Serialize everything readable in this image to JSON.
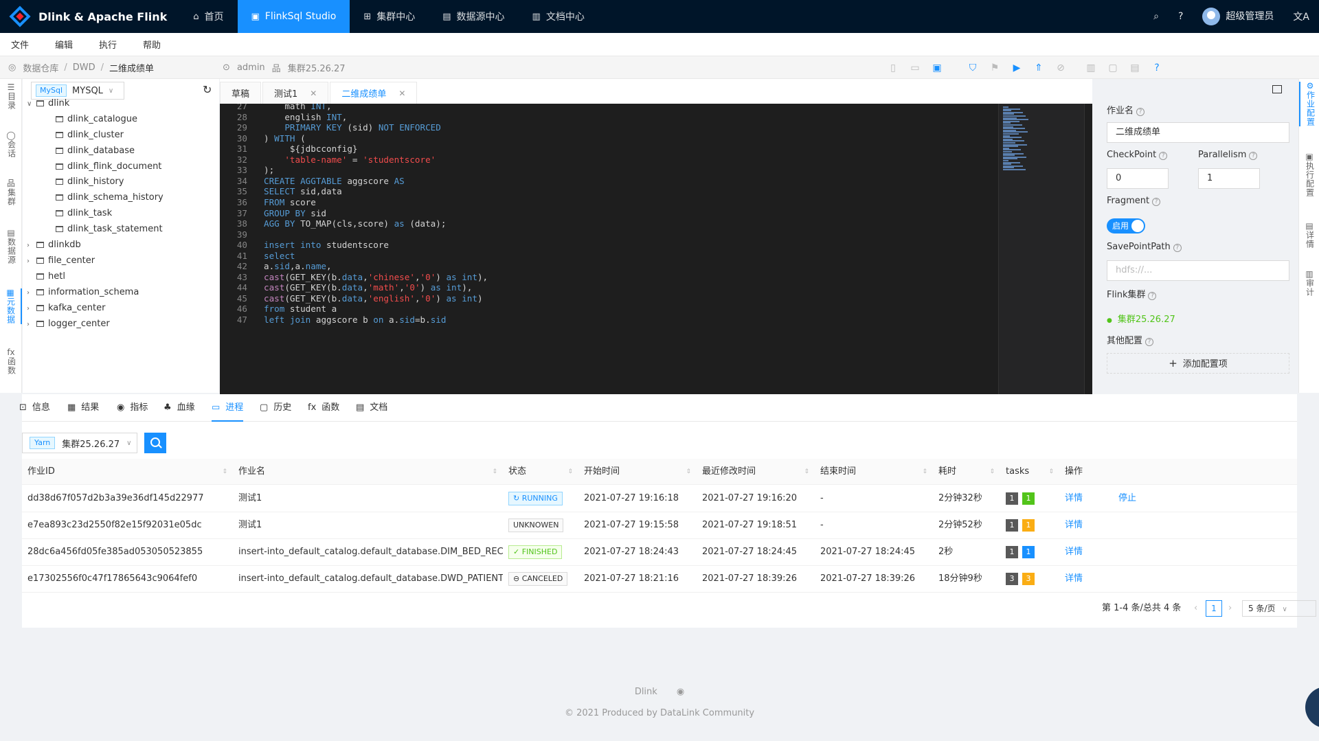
{
  "topbar": {
    "brand": "Dlink & Apache Flink",
    "nav": [
      {
        "icon": "home-icon",
        "glyph": "⌂",
        "label": "首页"
      },
      {
        "icon": "monitor-icon",
        "glyph": "▣",
        "label": "FlinkSql Studio"
      },
      {
        "icon": "cluster-icon",
        "glyph": "⊞",
        "label": "集群中心"
      },
      {
        "icon": "database-icon",
        "glyph": "▤",
        "label": "数据源中心"
      },
      {
        "icon": "document-icon",
        "glyph": "▥",
        "label": "文档中心"
      }
    ],
    "user": "超级管理员",
    "lang": "文A"
  },
  "menu": [
    "文件",
    "编辑",
    "执行",
    "帮助"
  ],
  "breadcrumb": {
    "items": [
      "数据仓库",
      "DWD"
    ],
    "current": "二维成绩单",
    "user": "admin",
    "cluster": "集群25.26.27"
  },
  "leftrail": [
    {
      "label": "目录",
      "icon": "list-icon"
    },
    {
      "label": "会话",
      "icon": "chat-icon"
    },
    {
      "label": "集群",
      "icon": "cluster-icon"
    },
    {
      "label": "数据源",
      "icon": "datasource-icon"
    },
    {
      "label": "元数据",
      "icon": "metadata-icon"
    },
    {
      "label": "函数",
      "icon": "function-icon"
    }
  ],
  "tree": {
    "db_tag": "MySql",
    "db_name": "MYSQL",
    "nodes": [
      {
        "label": "dlink",
        "expanded": true,
        "level": 0
      },
      {
        "label": "dlink_catalogue",
        "level": 1
      },
      {
        "label": "dlink_cluster",
        "level": 1
      },
      {
        "label": "dlink_database",
        "level": 1
      },
      {
        "label": "dlink_flink_document",
        "level": 1
      },
      {
        "label": "dlink_history",
        "level": 1
      },
      {
        "label": "dlink_schema_history",
        "level": 1
      },
      {
        "label": "dlink_task",
        "level": 1
      },
      {
        "label": "dlink_task_statement",
        "level": 1
      },
      {
        "label": "dlinkdb",
        "level": 0,
        "arrow": true
      },
      {
        "label": "file_center",
        "level": 0,
        "arrow": true
      },
      {
        "label": "hetl",
        "level": 0,
        "arrow": false
      },
      {
        "label": "information_schema",
        "level": 0,
        "arrow": true
      },
      {
        "label": "kafka_center",
        "level": 0,
        "arrow": true
      },
      {
        "label": "logger_center",
        "level": 0,
        "arrow": true
      }
    ]
  },
  "editor_tabs": [
    {
      "label": "草稿",
      "closable": false
    },
    {
      "label": "测试1",
      "closable": true
    },
    {
      "label": "二维成绩单",
      "closable": true,
      "active": true
    }
  ],
  "code": [
    {
      "n": "27",
      "t": "    math INT,"
    },
    {
      "n": "28",
      "t": "    english INT,"
    },
    {
      "n": "29",
      "t": "    PRIMARY KEY (sid) NOT ENFORCED"
    },
    {
      "n": "30",
      "t": ") WITH ("
    },
    {
      "n": "31",
      "t": "     ${jdbcconfig}"
    },
    {
      "n": "32",
      "t": "    'table-name' = 'studentscore'"
    },
    {
      "n": "33",
      "t": ");"
    },
    {
      "n": "34",
      "t": "CREATE AGGTABLE aggscore AS"
    },
    {
      "n": "35",
      "t": "SELECT sid,data"
    },
    {
      "n": "36",
      "t": "FROM score"
    },
    {
      "n": "37",
      "t": "GROUP BY sid"
    },
    {
      "n": "38",
      "t": "AGG BY TO_MAP(cls,score) as (data);"
    },
    {
      "n": "39",
      "t": ""
    },
    {
      "n": "40",
      "t": "insert into studentscore"
    },
    {
      "n": "41",
      "t": "select"
    },
    {
      "n": "42",
      "t": "a.sid,a.name,"
    },
    {
      "n": "43",
      "t": "cast(GET_KEY(b.data,'chinese','0') as int),"
    },
    {
      "n": "44",
      "t": "cast(GET_KEY(b.data,'math','0') as int),"
    },
    {
      "n": "45",
      "t": "cast(GET_KEY(b.data,'english','0') as int)"
    },
    {
      "n": "46",
      "t": "from student a"
    },
    {
      "n": "47",
      "t": "left join aggscore b on a.sid=b.sid"
    }
  ],
  "config": {
    "job_name_label": "作业名",
    "job_name": "二维成绩单",
    "checkpoint_label": "CheckPoint",
    "checkpoint": "0",
    "parallelism_label": "Parallelism",
    "parallelism": "1",
    "fragment_label": "Fragment",
    "fragment_switch": "启用",
    "savepoint_label": "SavePointPath",
    "savepoint_placeholder": "hdfs://...",
    "cluster_label": "Flink集群",
    "cluster": "集群25.26.27",
    "other_label": "其他配置",
    "add_label": "添加配置项"
  },
  "rightrail": [
    {
      "label": "作业配置",
      "icon": "settings-icon"
    },
    {
      "label": "执行配置",
      "icon": "execute-icon"
    },
    {
      "label": "详情",
      "icon": "detail-icon"
    },
    {
      "label": "审计",
      "icon": "audit-icon"
    }
  ],
  "bottom_tabs": [
    {
      "label": "信息",
      "icon": "terminal-icon",
      "glyph": "⊡"
    },
    {
      "label": "结果",
      "icon": "table-icon",
      "glyph": "▦"
    },
    {
      "label": "指标",
      "icon": "dashboard-icon",
      "glyph": "◉"
    },
    {
      "label": "血缘",
      "icon": "lineage-icon",
      "glyph": "♣"
    },
    {
      "label": "进程",
      "icon": "desktop-icon",
      "glyph": "▭",
      "active": true
    },
    {
      "label": "历史",
      "icon": "calendar-icon",
      "glyph": "▢"
    },
    {
      "label": "函数",
      "icon": "function-icon",
      "glyph": "fx"
    },
    {
      "label": "文档",
      "icon": "document-icon",
      "glyph": "▤"
    }
  ],
  "process": {
    "cluster_tag": "Yarn",
    "cluster": "集群25.26.27",
    "columns": [
      "作业ID",
      "作业名",
      "状态",
      "开始时间",
      "最近修改时间",
      "结束时间",
      "耗时",
      "tasks",
      "操作"
    ],
    "rows": [
      {
        "id": "dd38d67f057d2b3a39e36df145d22977",
        "name": "测试1",
        "status": "RUNNING",
        "status_type": "run",
        "start": "2021-07-27 19:16:18",
        "modified": "2021-07-27 19:16:20",
        "end": "-",
        "duration": "2分钟32秒",
        "tasks": [
          {
            "v": "1",
            "c": "gray"
          },
          {
            "v": "1",
            "c": "green"
          }
        ],
        "actions": [
          "详情",
          "停止"
        ]
      },
      {
        "id": "e7ea893c23d2550f82e15f92031e05dc",
        "name": "测试1",
        "status": "UNKNOWEN",
        "status_type": "unk",
        "start": "2021-07-27 19:15:58",
        "modified": "2021-07-27 19:18:51",
        "end": "-",
        "duration": "2分钟52秒",
        "tasks": [
          {
            "v": "1",
            "c": "gray"
          },
          {
            "v": "1",
            "c": "orange"
          }
        ],
        "actions": [
          "详情"
        ]
      },
      {
        "id": "28dc6a456fd05fe385ad053050523855",
        "name": "insert-into_default_catalog.default_database.DIM_BED_REC",
        "status": "FINISHED",
        "status_type": "fin",
        "start": "2021-07-27 18:24:43",
        "modified": "2021-07-27 18:24:45",
        "end": "2021-07-27 18:24:45",
        "duration": "2秒",
        "tasks": [
          {
            "v": "1",
            "c": "gray"
          },
          {
            "v": "1",
            "c": "blue"
          }
        ],
        "actions": [
          "详情"
        ]
      },
      {
        "id": "e17302556f0c47f17865643c9064fef0",
        "name": "insert-into_default_catalog.default_database.DWD_PATIENT_INHOSPITAL",
        "status": "CANCELED",
        "status_type": "can",
        "start": "2021-07-27 18:21:16",
        "modified": "2021-07-27 18:39:26",
        "end": "2021-07-27 18:39:26",
        "duration": "18分钟9秒",
        "tasks": [
          {
            "v": "3",
            "c": "gray"
          },
          {
            "v": "3",
            "c": "orange"
          }
        ],
        "actions": [
          "详情"
        ]
      }
    ],
    "pagination": {
      "summary": "第 1-4 条/总共 4 条",
      "page": "1",
      "size": "5 条/页"
    }
  },
  "footer": {
    "brand": "Dlink",
    "copyright": "2021 Produced by DataLink Community"
  }
}
